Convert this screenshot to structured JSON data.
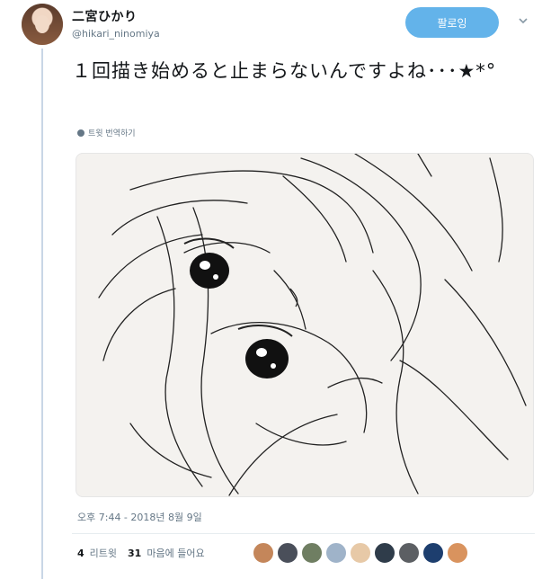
{
  "tweet": {
    "display_name": "二宮ひかり",
    "handle": "@hikari_ninomiya",
    "follow_label": "팔로잉",
    "text": "１回描き始めると止まらないんですよね･･･★*°",
    "translate_label": "트윗 번역하기",
    "timestamp": "오후 7:44 - 2018년 8월 9일",
    "retweet_count": "4",
    "retweet_label": "리트윗",
    "like_count": "31",
    "like_label": "마음에 들어요"
  },
  "likers": [
    {
      "color": "#c4865a",
      "icon": "avatar"
    },
    {
      "color": "#4a4f5a",
      "icon": "avatar"
    },
    {
      "color": "#6f7e62",
      "icon": "avatar"
    },
    {
      "color": "#9fb3c9",
      "icon": "avatar"
    },
    {
      "color": "#e7c9a7",
      "icon": "avatar"
    },
    {
      "color": "#2f3c4a",
      "icon": "avatar"
    },
    {
      "color": "#5c5f63",
      "icon": "avatar"
    },
    {
      "color": "#1d3e6e",
      "icon": "avatar"
    },
    {
      "color": "#d9935e",
      "icon": "avatar"
    }
  ],
  "colors": {
    "accent": "#63b3ea",
    "muted": "#657786"
  }
}
